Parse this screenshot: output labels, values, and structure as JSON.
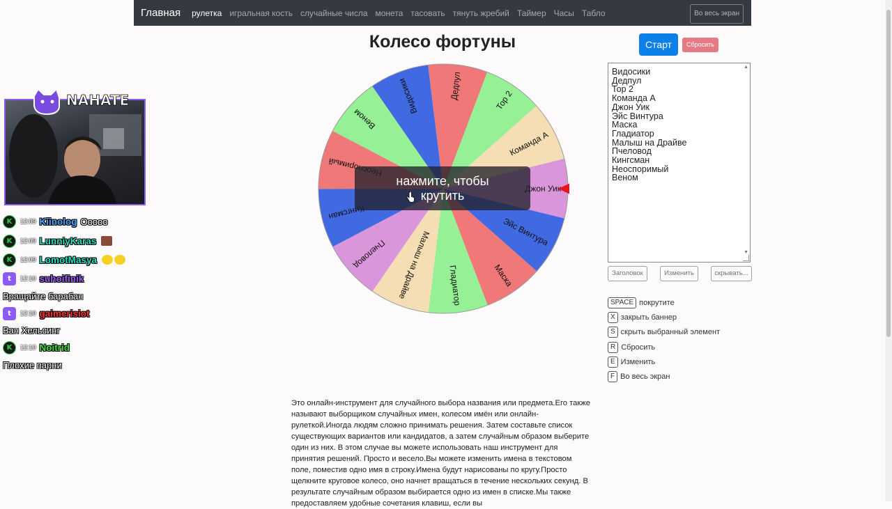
{
  "navbar": {
    "brand": "Главная",
    "items": [
      "рулетка",
      "игральная кость",
      "случайные числа",
      "монета",
      "тасовать",
      "тянуть жребий",
      "Таймер",
      "Часы",
      "Табло"
    ],
    "fullscreen": "Во весь экран"
  },
  "page_title": "Колесо фортуны",
  "buttons": {
    "start": "Старт",
    "reset": "Сбросить"
  },
  "wheel": {
    "overlay_text": "нажмите, чтобы крутить",
    "segments": [
      {
        "label": "Видосики",
        "color": "#4169e1"
      },
      {
        "label": "Дедпул",
        "color": "#f07878"
      },
      {
        "label": "Тор 2",
        "color": "#96f096"
      },
      {
        "label": "Команда А",
        "color": "#f5deb3"
      },
      {
        "label": "Джон Уик",
        "color": "#da96da"
      },
      {
        "label": "Эйс Винтура",
        "color": "#4169e1"
      },
      {
        "label": "Маска",
        "color": "#f07878"
      },
      {
        "label": "Гладиатор",
        "color": "#96f096"
      },
      {
        "label": "Малыш на Драйве",
        "color": "#f5deb3"
      },
      {
        "label": "Пчеловод",
        "color": "#da96da"
      },
      {
        "label": "Кингсман",
        "color": "#4169e1"
      },
      {
        "label": "Неоспоримый",
        "color": "#f07878"
      },
      {
        "label": "Веном",
        "color": "#96f096"
      }
    ],
    "pointer_color": "#e8141e"
  },
  "names_list": "Видосики\nДедпул\nТор 2\nКоманда А\nДжон Уик\nЭйс Винтура\nМаска\nГладиатор\nМалыш на Драйве\nПчеловод\nКингсман\nНеоспоримый\nВеном",
  "list_buttons": {
    "header": "Заголовок",
    "edit": "Изменить",
    "hide": "скрывать..."
  },
  "shortcuts": [
    {
      "key": "SPACE",
      "label": "покрутите"
    },
    {
      "key": "X",
      "label": "закрыть баннер"
    },
    {
      "key": "S",
      "label": "скрыть выбранный элемент"
    },
    {
      "key": "R",
      "label": "Сбросить"
    },
    {
      "key": "E",
      "label": "Изменить"
    },
    {
      "key": "F",
      "label": "Во весь экран"
    }
  ],
  "description": "Это онлайн-инструмент для случайного выбора названия или предмета.Его также называют выборщиком случайных имен, колесом имён или онлайн-рулеткой.Иногда людям сложно принимать решения. Затем составьте список существующих вариантов или кандидатов, а затем случайным образом выберите один из них. В этом случае вы можете использовать наш инструмент для принятия решений. Просто и весело.Вы можете изменить имена в текстовом поле, поместив одно имя в строку.Имена будут нарисованы по кругу.Просто щелкните круговое колесо, оно начнет вращаться в течение нескольких секунд. В результате случайным образом выбирается одно из имен в списке.Мы также предоставляем удобные сочетания клавиш, если вы",
  "stream": {
    "streamer_name": "NAHATE",
    "chat": [
      {
        "platform": "kick",
        "time": "12:09",
        "nick": "Kiinolog",
        "nick_color": "#4aa3ff",
        "message": "Ооооо"
      },
      {
        "platform": "kick",
        "time": "12:09",
        "nick": "LunniyKaras",
        "nick_color": "#2fe0c0",
        "message": ""
      },
      {
        "platform": "kick",
        "time": "12:09",
        "nick": "LomotMasya",
        "nick_color": "#2fe0c0",
        "message": ""
      },
      {
        "platform": "twitch",
        "time": "12:10",
        "nick": "suhoifinik",
        "nick_color": "#9b5cff",
        "message": ""
      },
      {
        "platform": "text",
        "message": "Вращайте барабан"
      },
      {
        "platform": "twitch",
        "time": "12:10",
        "nick": "gaimerisiot",
        "nick_color": "#ff3030",
        "message": ""
      },
      {
        "platform": "text",
        "message": "Ван Хельсинг"
      },
      {
        "platform": "kick",
        "time": "12:10",
        "nick": "Noitrid",
        "nick_color": "#3ee03e",
        "message": ""
      },
      {
        "platform": "text",
        "message": "Плохие парни"
      }
    ]
  }
}
